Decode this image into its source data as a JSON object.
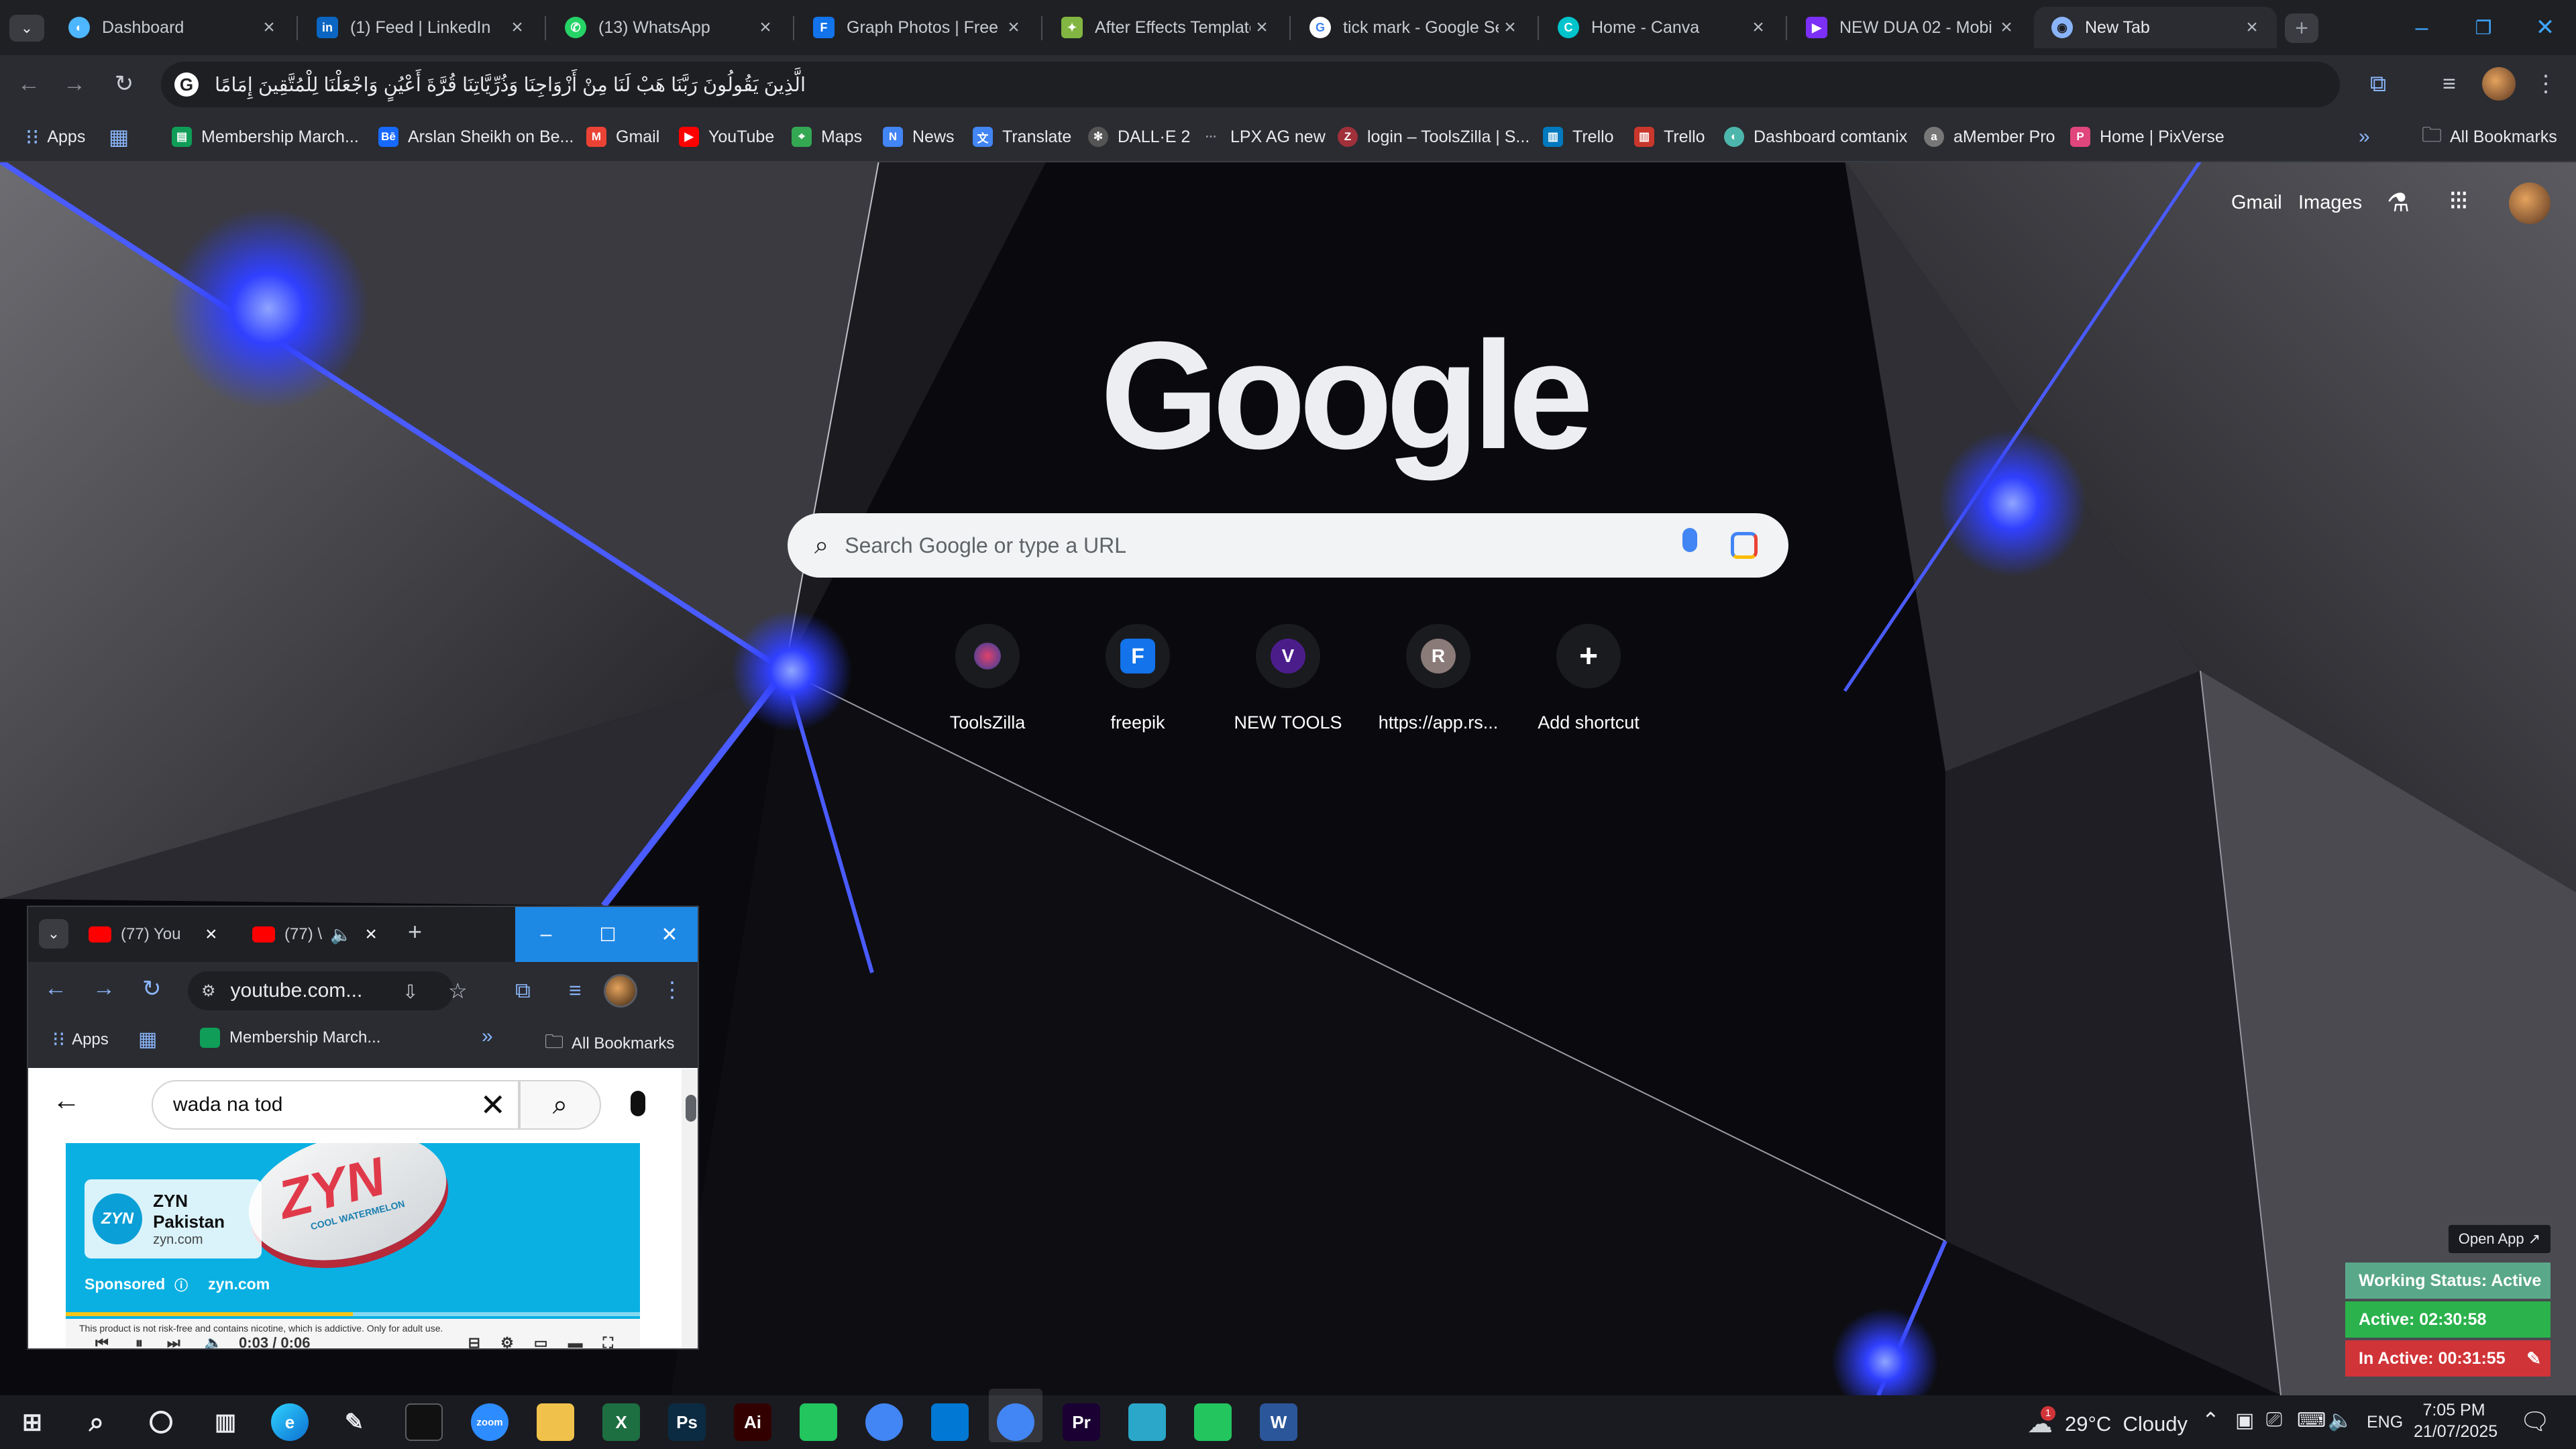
{
  "browser": {
    "tabs": [
      {
        "title": "Dashboard",
        "icon": "dashboard-favicon",
        "color": "#4db6ff"
      },
      {
        "title": "(1) Feed | LinkedIn",
        "icon": "linkedin-favicon",
        "color": "#0a66c2"
      },
      {
        "title": "(13) WhatsApp",
        "icon": "whatsapp-favicon",
        "color": "#25d366"
      },
      {
        "title": "Graph Photos | Free d",
        "icon": "freepik-favicon",
        "color": "#1273eb"
      },
      {
        "title": "After Effects Template",
        "icon": "envato-favicon",
        "color": "#82b541"
      },
      {
        "title": "tick mark - Google Se",
        "icon": "google-favicon",
        "color": "#ffffff"
      },
      {
        "title": "Home - Canva",
        "icon": "canva-favicon",
        "color": "#00c4cc"
      },
      {
        "title": "NEW DUA 02 - Mobi",
        "icon": "video-favicon",
        "color": "#7b2ff7"
      },
      {
        "title": "New Tab",
        "icon": "chrome-favicon",
        "color": "#8ab4f8"
      }
    ],
    "omnibox_text": "الَّذِينَ يَقُولُونَ رَبَّنَا هَبْ لَنَا مِنْ أَزْوَاجِنَا وَذُرِّيَّاتِنَا قُرَّةَ أَعْيُنٍ وَاجْعَلْنَا لِلْمُتَّقِينَ إِمَامًا",
    "bookmarks": [
      {
        "label": "Apps",
        "icon": "apps-grid-icon"
      },
      {
        "label": "Membership March...",
        "icon": "sheets-icon",
        "color": "#0f9d58"
      },
      {
        "label": "Arslan Sheikh on Be...",
        "icon": "behance-icon",
        "color": "#1769ff"
      },
      {
        "label": "Gmail",
        "icon": "gmail-icon",
        "color": "#ea4335"
      },
      {
        "label": "YouTube",
        "icon": "youtube-icon",
        "color": "#ff0000"
      },
      {
        "label": "Maps",
        "icon": "maps-icon",
        "color": "#34a853"
      },
      {
        "label": "News",
        "icon": "news-icon",
        "color": "#4285f4"
      },
      {
        "label": "Translate",
        "icon": "translate-icon",
        "color": "#4285f4"
      },
      {
        "label": "DALL·E 2",
        "icon": "openai-icon",
        "color": "#888888"
      },
      {
        "label": "LPX AG new",
        "icon": "link-icon",
        "color": "#555555"
      },
      {
        "label": "login – ToolsZilla | S...",
        "icon": "toolszilla-icon",
        "color": "#a0303a"
      },
      {
        "label": "Trello",
        "icon": "trello-icon",
        "color": "#0079bf"
      },
      {
        "label": "Trello",
        "icon": "trello-alt-icon",
        "color": "#c9372c"
      },
      {
        "label": "Dashboard comtanix",
        "icon": "dashboard-icon",
        "color": "#4db6ac"
      },
      {
        "label": "aMember Pro",
        "icon": "amember-icon",
        "color": "#777777"
      },
      {
        "label": "Home | PixVerse",
        "icon": "pixverse-icon",
        "color": "#e0457b"
      }
    ],
    "all_bookmarks_label": "All Bookmarks"
  },
  "newtab": {
    "links": {
      "gmail": "Gmail",
      "images": "Images"
    },
    "logo_text": "Google",
    "search_placeholder": "Search Google or type a URL",
    "shortcuts": [
      {
        "label": "ToolsZilla",
        "icon": "toolszilla-icon",
        "initial": ""
      },
      {
        "label": "freepik",
        "icon": "freepik-icon",
        "initial": ""
      },
      {
        "label": "NEW TOOLS",
        "icon": "letter-v-icon",
        "initial": "V"
      },
      {
        "label": "https://app.rs...",
        "icon": "letter-r-icon",
        "initial": "R"
      },
      {
        "label": "Add shortcut",
        "icon": "plus-icon",
        "initial": "+"
      }
    ]
  },
  "mini_window": {
    "tabs": [
      {
        "title": "(77) You"
      },
      {
        "title": "(77) \\"
      }
    ],
    "url": "youtube.com...",
    "bookmarks": [
      {
        "label": "Apps"
      },
      {
        "label": "Membership March..."
      }
    ],
    "all_bookmarks_label": "All Bookmarks",
    "search_query": "wada na tod",
    "ad": {
      "brand": "ZYN Pakistan",
      "domain": "zyn.com",
      "sponsored": "Sponsored",
      "sponsored_domain": "zyn.com",
      "logo_text": "ZYN",
      "product_text": "ZYN",
      "flavour": "COOL WATERMELON",
      "time": "0:03 / 0:06",
      "disclaimer": "This product is not risk-free and contains nicotine, which is addictive. Only for adult use.",
      "progress": 0.5
    }
  },
  "widget": {
    "open_app": "Open App ↗",
    "working_status": "Working Status: Active",
    "active": "Active: 02:30:58",
    "inactive": "In Active: 00:31:55",
    "colors": {
      "status": "#5aa88a",
      "active": "#2bb24c",
      "inactive": "#d13438"
    }
  },
  "taskbar": {
    "apps": [
      {
        "name": "zoom-icon",
        "label": "zoom",
        "color": "#2d8cff"
      },
      {
        "name": "file-explorer-icon",
        "label": "",
        "color": "#f0c24b"
      },
      {
        "name": "excel-icon",
        "label": "X",
        "color": "#1d6f42"
      },
      {
        "name": "photoshop-icon",
        "label": "Ps",
        "color": "#0b2b42"
      },
      {
        "name": "illustrator-icon",
        "label": "Ai",
        "color": "#330000"
      },
      {
        "name": "phone-link-icon",
        "label": "",
        "color": "#22c55e"
      },
      {
        "name": "chrome-icon",
        "label": "",
        "color": "#4285f4"
      },
      {
        "name": "vscode-icon",
        "label": "",
        "color": "#0078d4"
      },
      {
        "name": "chrome-active-icon",
        "label": "",
        "color": "#4285f4"
      },
      {
        "name": "premiere-icon",
        "label": "Pr",
        "color": "#1a0033"
      },
      {
        "name": "app-icon",
        "label": "",
        "color": "#2aa7c9"
      },
      {
        "name": "phone-link-2-icon",
        "label": "",
        "color": "#22c55e"
      },
      {
        "name": "word-icon",
        "label": "W",
        "color": "#2b579a"
      }
    ],
    "weather": "29°C  Cloudy",
    "weather_badge": "1",
    "language": "ENG",
    "time": "7:05 PM",
    "date": "21/07/2025"
  }
}
